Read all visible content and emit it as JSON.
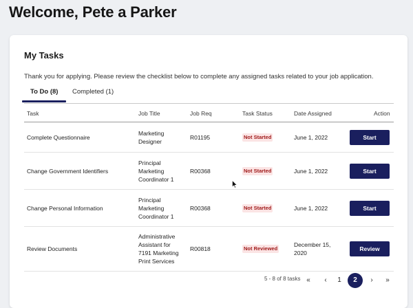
{
  "header": {
    "welcome": "Welcome, Pete a Parker"
  },
  "card": {
    "title": "My Tasks",
    "intro": "Thank you for applying. Please review the checklist below to complete any assigned tasks related to your job application."
  },
  "tabs": [
    {
      "label": "To Do (8)",
      "active": true
    },
    {
      "label": "Completed (1)",
      "active": false
    }
  ],
  "table": {
    "columns": [
      "Task",
      "Job Title",
      "Job Req",
      "Task Status",
      "Date Assigned",
      "Action"
    ],
    "rows": [
      {
        "task": "Complete Questionnaire",
        "job_title": [
          "Marketing",
          "Designer"
        ],
        "job_req": "R01195",
        "status": "Not Started",
        "date": [
          "June 1, 2022"
        ],
        "action": "Start"
      },
      {
        "task": "Change Government Identifiers",
        "job_title": [
          "Principal",
          "Marketing",
          "Coordinator 1"
        ],
        "job_req": "R00368",
        "status": "Not Started",
        "date": [
          "June 1, 2022"
        ],
        "action": "Start"
      },
      {
        "task": "Change Personal Information",
        "job_title": [
          "Principal",
          "Marketing",
          "Coordinator 1"
        ],
        "job_req": "R00368",
        "status": "Not Started",
        "date": [
          "June 1, 2022"
        ],
        "action": "Start"
      },
      {
        "task": "Review Documents",
        "job_title": [
          "Administrative",
          "Assistant for",
          "7191 Marketing",
          "Print Services"
        ],
        "job_req": "R00818",
        "status": "Not Reviewed",
        "date": [
          "December 15,",
          "2020"
        ],
        "action": "Review"
      }
    ]
  },
  "pagination": {
    "range": "5 - 8 of 8 tasks",
    "first_icon": "double-chevron-left-icon",
    "prev_icon": "chevron-left-icon",
    "pages": [
      "1",
      "2"
    ],
    "current_page": "2",
    "next_icon": "chevron-right-icon",
    "last_icon": "double-chevron-right-icon",
    "first_glyph": "«",
    "prev_glyph": "‹",
    "next_glyph": "›",
    "last_glyph": "»"
  },
  "colors": {
    "primary": "#1a1f5e",
    "status_text": "#a01b1b",
    "status_bg": "#fbe4e4",
    "page_bg": "#eef0f3"
  }
}
